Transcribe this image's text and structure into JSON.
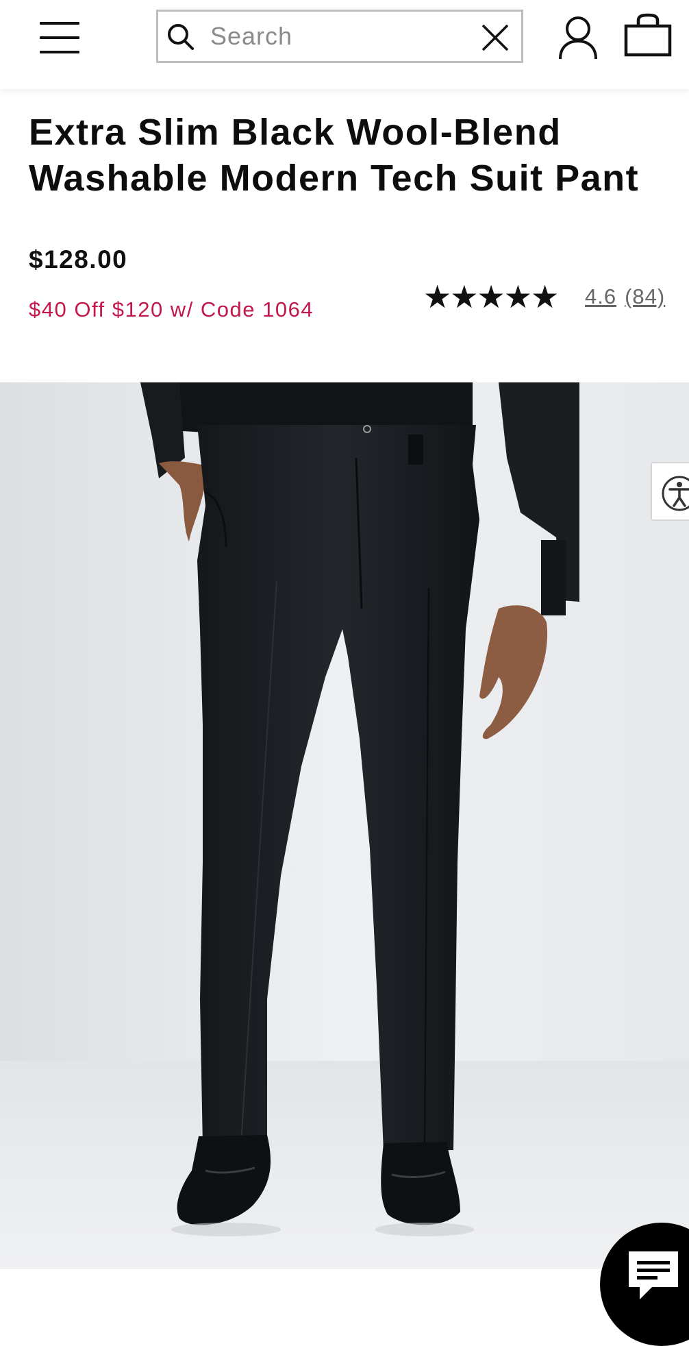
{
  "header": {
    "search": {
      "placeholder": "Search",
      "value": ""
    },
    "icons": [
      "menu-icon",
      "search-icon",
      "close-icon",
      "account-icon",
      "shopping-bag-icon"
    ]
  },
  "product": {
    "title": "Extra Slim Black Wool-Blend Washable Modern Tech Suit Pant",
    "price": "$128.00",
    "promo": "$40 Off $120 w/ Code 1064",
    "rating": {
      "value": "4.6",
      "count": "(84)",
      "max_stars": 5,
      "fill_fraction": 0.92
    }
  },
  "colors": {
    "promo": "#c2184b",
    "text": "#111111",
    "muted": "#666666"
  },
  "floating": {
    "accessibility_icon": "accessibility-icon",
    "chat_icon": "chat-icon"
  }
}
